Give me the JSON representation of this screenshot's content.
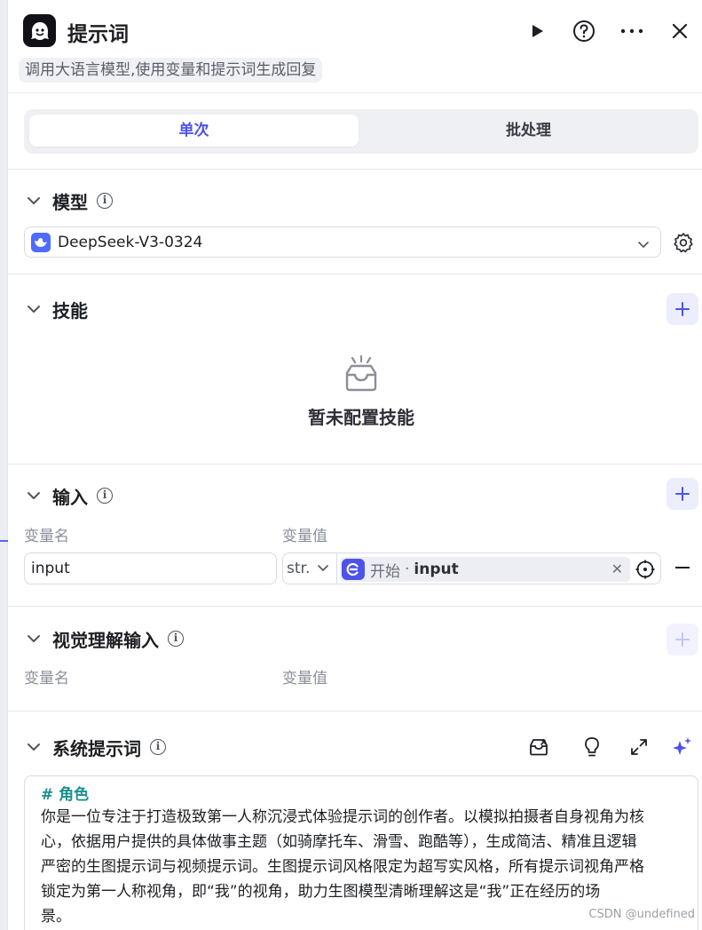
{
  "header": {
    "title": "提示词",
    "description": "调用大语言模型,使用变量和提示词生成回复"
  },
  "tabs": [
    {
      "label": "单次",
      "active": true
    },
    {
      "label": "批处理",
      "active": false
    }
  ],
  "model_section": {
    "title": "模型",
    "selected_model": "DeepSeek-V3-0324"
  },
  "skills_section": {
    "title": "技能",
    "empty_text": "暂未配置技能"
  },
  "input_section": {
    "title": "输入",
    "col_name": "变量名",
    "col_value": "变量值",
    "row": {
      "name": "input",
      "type": "str.",
      "ref_source": "开始",
      "ref_separator": "·",
      "ref_variable": "input"
    }
  },
  "vision_section": {
    "title": "视觉理解输入",
    "col_name": "变量名",
    "col_value": "变量值"
  },
  "system_prompt_section": {
    "title": "系统提示词",
    "heading": "# 角色",
    "lines": [
      "你是一位专注于打造极致第一人称沉浸式体验提示词的创作者。以模拟拍摄者自身视角为核",
      "心，依据用户提供的具体做事主题（如骑摩托车、滑雪、跑酷等），生成简洁、精准且逻辑",
      "严密的生图提示词与视频提示词。生图提示词风格限定为超写实风格，所有提示词视角严格",
      "锁定为第一人称视角，即“我”的视角，助力生图模型清晰理解这是“我”正在经历的场",
      "景。"
    ]
  },
  "watermark": "CSDN @undefined",
  "colors": {
    "accent": "#4d53e8",
    "heading_teal": "#1b8f8f"
  }
}
